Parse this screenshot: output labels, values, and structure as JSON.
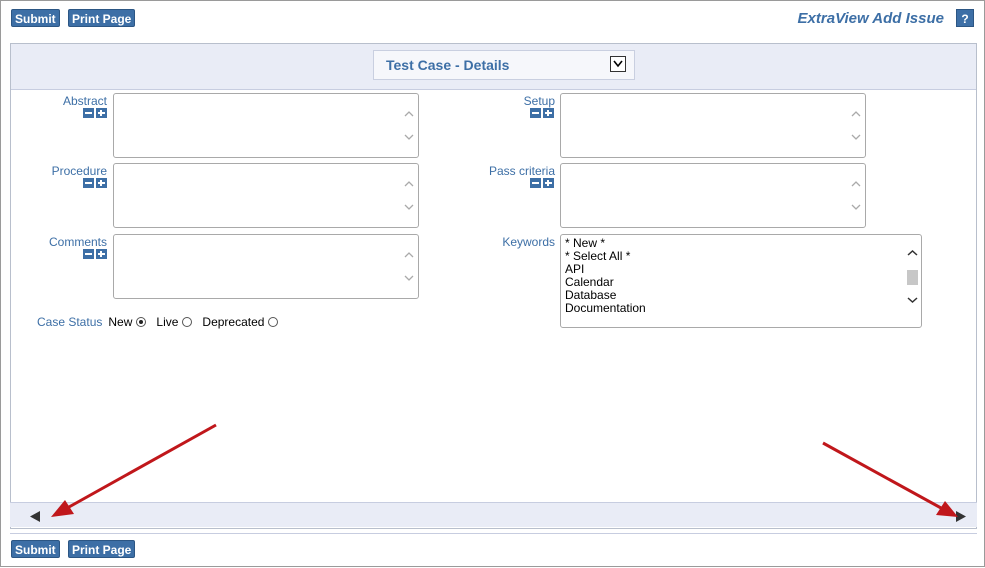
{
  "toolbar": {
    "submit_label": "Submit",
    "print_label": "Print Page"
  },
  "header": {
    "title": "ExtraView Add Issue",
    "help_label": "?"
  },
  "tab": {
    "label": "Test Case - Details"
  },
  "fields": {
    "abstract": "Abstract",
    "setup": "Setup",
    "procedure": "Procedure",
    "pass_criteria": "Pass criteria",
    "comments": "Comments",
    "keywords": "Keywords",
    "case_status": "Case Status"
  },
  "case_status_options": [
    {
      "label": "New",
      "selected": true
    },
    {
      "label": "Live",
      "selected": false
    },
    {
      "label": "Deprecated",
      "selected": false
    }
  ],
  "keywords_options": [
    "* New *",
    "* Select All *",
    "API",
    "Calendar",
    "Database",
    "Documentation"
  ],
  "colors": {
    "accent": "#3d6fa6",
    "panel_bg": "#e9ecf6",
    "annotation_arrow": "#c0171b"
  },
  "icons": {
    "prev": "triangle-left-icon",
    "next": "triangle-right-icon",
    "expand": "plus-icon",
    "collapse": "minus-icon"
  }
}
